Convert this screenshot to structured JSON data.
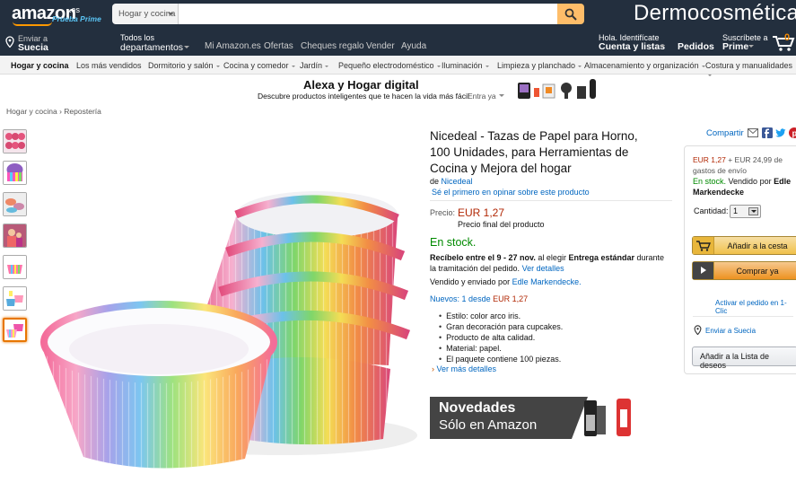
{
  "header": {
    "logo_text": "amazon",
    "logo_suffix": ".es",
    "logo_prime": "Prueba Prime",
    "search_category": "Hogar y cocina",
    "search_placeholder": "",
    "store_banner": "Dermocosmética"
  },
  "nav": {
    "deliver_label": "Enviar a",
    "deliver_location": "Suecia",
    "departments_label": "Todos los",
    "departments_text": "departamentos",
    "links": [
      "Mi Amazon.es",
      "Ofertas",
      "Cheques regalo",
      "Vender",
      "Ayuda"
    ],
    "account_label": "Hola. Identifícate",
    "account_text": "Cuenta y listas",
    "orders": "Pedidos",
    "prime_label": "Suscríbete a",
    "prime_text": "Prime",
    "cart_count": "0"
  },
  "subnav": {
    "items": [
      "Hogar y cocina",
      "Los más vendidos",
      "Dormitorio y salón",
      "Cocina y comedor",
      "Jardín",
      "Pequeño electrodoméstico",
      "Iluminación",
      "Limpieza y planchado",
      "Almacenamiento y organización",
      "Costura y manualidades"
    ]
  },
  "promo": {
    "title": "Alexa y Hogar digital",
    "subtitle": "Descubre productos inteligentes que te hacen la vida más fácil",
    "see_more": "Entra ya"
  },
  "breadcrumb": {
    "items": [
      "Hogar y cocina",
      "Repostería"
    ],
    "separator": "›"
  },
  "product": {
    "title": "Nicedeal - Tazas de Papel para Horno, 100 Unidades, para Herramientas de Cocina y Mejora del hogar",
    "by_label": "de",
    "brand": "Nicedeal",
    "review_prompt": "Sé el primero en opinar sobre este producto",
    "price_label": "Precio:",
    "price": "EUR 1,27",
    "price_note": "Precio final del producto",
    "availability": "En stock.",
    "delivery_prefix": "Recíbelo entre el",
    "delivery_dates": "9 - 27 nov.",
    "delivery_middle": "al elegir",
    "delivery_option": "Entrega estándar",
    "delivery_suffix": "durante la tramitación del pedido.",
    "delivery_details": "Ver detalles",
    "seller_prefix": "Vendido y enviado por",
    "seller": "Edle Markendecke.",
    "offers_label": "Nuevos:",
    "offers_text": "1 desde",
    "offers_price": "EUR 1,27",
    "bullets": [
      "Estilo: color arco iris.",
      "Gran decoración para cupcakes.",
      "Producto de alta calidad.",
      "Material: papel.",
      "El paquete contiene 100 piezas."
    ],
    "more_details": "Ver más detalles"
  },
  "novedades": {
    "title": "Novedades",
    "subtitle": "Sólo en Amazon"
  },
  "buybox": {
    "share_label": "Compartir",
    "price": "EUR 1,27",
    "shipping": "+ EUR 24,99 de gastos de envío",
    "stock": "En stock.",
    "sold_by_prefix": "Vendido por",
    "sold_by": "Edle Markendecke",
    "qty_label": "Cantidad:",
    "qty_value": "1",
    "add_to_cart": "Añadir a la cesta",
    "buy_now": "Comprar ya",
    "one_click": "Activar el pedido en 1-Clic",
    "ship_to": "Enviar a Suecia",
    "add_to_list": "Añadir a la Lista de deseos"
  },
  "colors": {
    "header_bg": "#232f3e",
    "accent": "#febd69",
    "price": "#b12704",
    "stock": "#008a00",
    "link": "#0066c0"
  }
}
